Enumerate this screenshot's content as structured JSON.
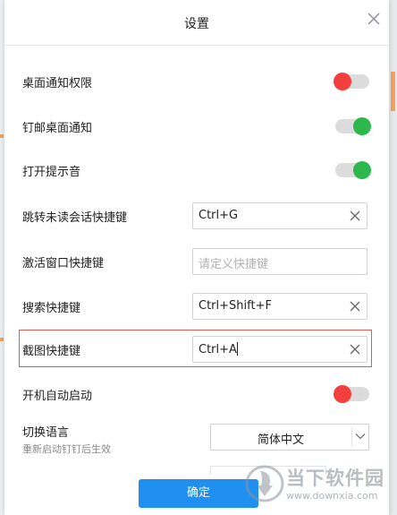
{
  "dialog": {
    "title": "设置",
    "confirm_label": "确定"
  },
  "settings": {
    "desktop_notification_permission": {
      "label": "桌面通知权限",
      "enabled": false
    },
    "dingmail_desktop_notification": {
      "label": "钉邮桌面通知",
      "enabled": true
    },
    "notification_sound": {
      "label": "打开提示音",
      "enabled": true
    },
    "unread_conversation_shortcut": {
      "label": "跳转未读会话快捷键",
      "value": "Ctrl+G",
      "placeholder": ""
    },
    "activate_window_shortcut": {
      "label": "激活窗口快捷键",
      "value": "",
      "placeholder": "请定义快捷键"
    },
    "search_shortcut": {
      "label": "搜索快捷键",
      "value": "Ctrl+Shift+F",
      "placeholder": ""
    },
    "screenshot_shortcut": {
      "label": "截图快捷键",
      "value": "Ctrl+A",
      "placeholder": ""
    },
    "auto_start": {
      "label": "开机自动启动",
      "enabled": false
    },
    "language": {
      "label": "切换语言",
      "hint": "重新启动钉钉后生效",
      "selected": "简体中文"
    }
  },
  "colors": {
    "toggle_on": "#2db84d",
    "toggle_off": "#f3403f",
    "primary_button": "#1f8ff0",
    "highlight_border": "#e05a4e"
  },
  "icons": {
    "close": "close-icon",
    "clear": "clear-icon",
    "dropdown": "chevron-down-icon"
  },
  "watermark": {
    "title": "当下软件园",
    "url": "www.downxia.com"
  }
}
